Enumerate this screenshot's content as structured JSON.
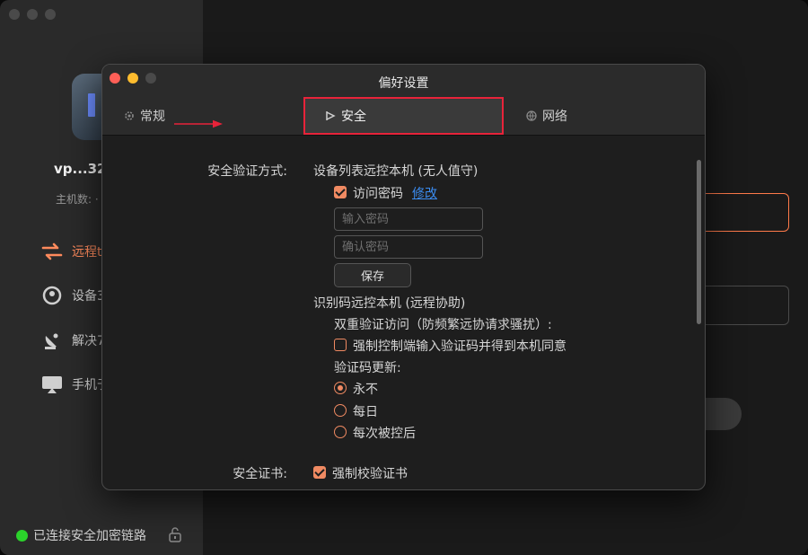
{
  "main": {
    "device_name": "vp...32",
    "host_count": "主机数: ·",
    "nav": [
      "远程t",
      "设备3",
      "解决7",
      "手机于"
    ],
    "status": "已连接安全加密链路"
  },
  "dialog": {
    "title": "偏好设置",
    "tabs": [
      {
        "label": "常规",
        "icon": "gear-icon"
      },
      {
        "label": "安全",
        "icon": "flag-icon"
      },
      {
        "label": "网络",
        "icon": "globe-icon"
      }
    ],
    "auth_label": "安全验证方式:",
    "device_list_title": "设备列表远控本机 (无人值守)",
    "access_password": "访问密码",
    "modify_link": "修改",
    "password_placeholder": "输入密码",
    "confirm_placeholder": "确认密码",
    "save_label": "保存",
    "id_code_title": "识别码远控本机 (远程协助)",
    "two_factor_label": "双重验证访问（防频繁远协请求骚扰）:",
    "force_verify_label": "强制控制端输入验证码并得到本机同意",
    "code_update_label": "验证码更新:",
    "radio_options": [
      "永不",
      "每日",
      "每次被控后"
    ],
    "cert_label": "安全证书:",
    "force_cert_label": "强制校验证书"
  },
  "colors": {
    "accent": "#f08a62",
    "highlight": "#e8233a",
    "link": "#3b8cf0"
  }
}
